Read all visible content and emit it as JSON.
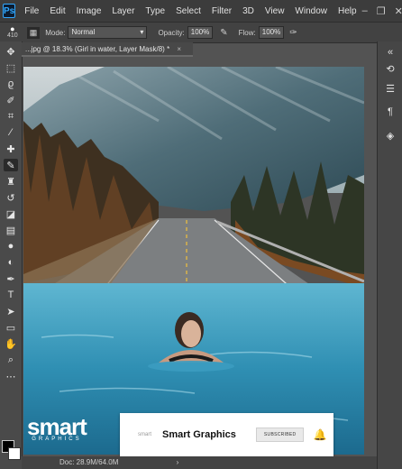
{
  "app": {
    "logo_text": "Ps"
  },
  "menu": [
    "File",
    "Edit",
    "Image",
    "Layer",
    "Type",
    "Select",
    "Filter",
    "3D",
    "View",
    "Window",
    "Help"
  ],
  "window_controls": [
    "–",
    "❐",
    "✕"
  ],
  "options_bar": {
    "brush_size": "410",
    "mode_label": "Mode:",
    "mode_value": "Normal",
    "opacity_label": "Opacity:",
    "opacity_value": "100%",
    "flow_label": "Flow:",
    "flow_value": "100%"
  },
  "document_tab": {
    "title": "...jpg @ 18.3% (Girl in water, Layer Mask/8) *",
    "close": "×"
  },
  "status_bar": {
    "doc_info": "Doc: 28.9M/64.0M"
  },
  "overlay": {
    "logo_word": "smart",
    "logo_sub": "GRAPHICS",
    "banner_small_logo": "smart",
    "channel_name": "Smart Graphics",
    "subscribe_label": "SUBSCRIBED"
  },
  "colors": {
    "accent": "#31a8ff",
    "ui_dark": "#3c3c3c",
    "panel": "#535353"
  }
}
